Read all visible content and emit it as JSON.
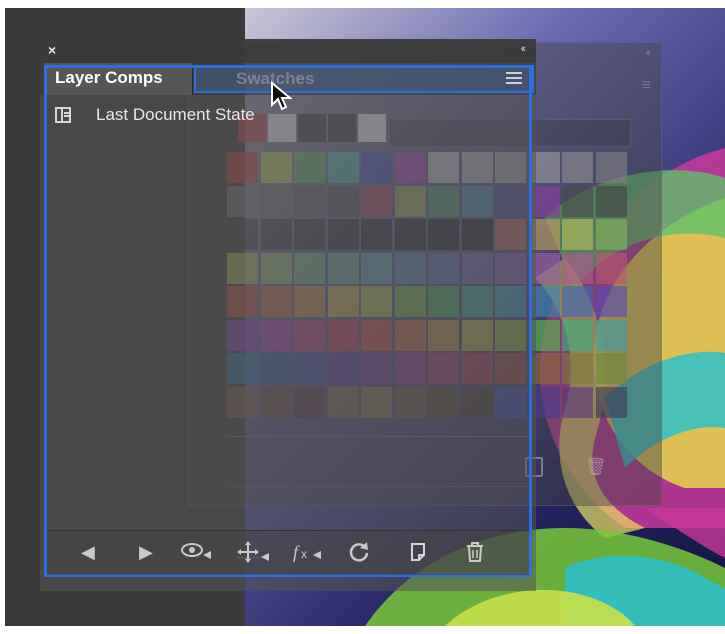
{
  "panel": {
    "close_glyph": "×",
    "collapse_glyph": "‹‹",
    "tabs": [
      {
        "label": "Layer Comps",
        "active": true
      },
      {
        "label": "Swatches",
        "active": false,
        "dragging": true
      }
    ],
    "menu_icon": "hamburger-menu-icon",
    "comps": [
      {
        "label": "Last Document State",
        "icon": "layer-comp-icon"
      }
    ],
    "toolbar": [
      {
        "name": "previous-comp-button",
        "icon": "triangle-left-icon",
        "glyph": "◀"
      },
      {
        "name": "next-comp-button",
        "icon": "triangle-right-icon",
        "glyph": "▶"
      },
      {
        "name": "visibility-button",
        "icon": "eye-icon",
        "glyph": "👁"
      },
      {
        "name": "position-button",
        "icon": "move-arrows-icon",
        "glyph": "✥"
      },
      {
        "name": "style-button",
        "icon": "fx-icon",
        "glyph": "fx"
      },
      {
        "name": "update-button",
        "icon": "refresh-icon",
        "glyph": "↻"
      },
      {
        "name": "new-comp-button",
        "icon": "new-page-icon",
        "glyph": ""
      },
      {
        "name": "delete-button",
        "icon": "trash-icon",
        "glyph": "🗑"
      }
    ]
  },
  "ghost_panel": {
    "close_glyph": "×",
    "collapse_glyph": "‹‹",
    "menu_glyph": "≡",
    "trash_glyph": "🗑"
  },
  "swatches": {
    "recent": [
      "#b13f47",
      "#e0e0e0",
      "#3a3a3a",
      "#3a3a3a",
      "#e8e8e8"
    ],
    "grid": [
      [
        "#c23b3b",
        "#b8c84a",
        "#5fb05f",
        "#49b3a8",
        "#3d4fb8",
        "#b03fb8",
        "#c6c6c6",
        "#b6b6b6",
        "#a9a9a9",
        "#9a9a9a",
        "#8d8d8d",
        "#808080"
      ],
      [
        "#767676",
        "#6a6a6a",
        "#5e5e5e",
        "#525252",
        "#b0465a",
        "#9fb04a",
        "#4e9a6b",
        "#4a8fb2",
        "#474c9a",
        "#8c3c9f",
        "#4b4b4b",
        "#444444"
      ],
      [
        "#3e3e3e",
        "#373737",
        "#323232",
        "#2c2c2c",
        "#262626",
        "#222222",
        "#1f1f1f",
        "#1b1b1b",
        "#c46b5a",
        "#c4a05a",
        "#b8c05a",
        "#7fb85a"
      ],
      [
        "#a8b85f",
        "#8fb86a",
        "#77b07a",
        "#6aa890",
        "#5fa0a8",
        "#5a88b0",
        "#6078b0",
        "#7068b0",
        "#8a62b0",
        "#a05ea8",
        "#b05a90",
        "#b85a70"
      ],
      [
        "#c24a3a",
        "#c86a3a",
        "#c88a3a",
        "#c8aa3a",
        "#a8c03a",
        "#78b83a",
        "#4ab05a",
        "#3ab08a",
        "#3aa8b0",
        "#3a88b8",
        "#3a68b8",
        "#5a4ab8"
      ],
      [
        "#8a3ab8",
        "#b03aa8",
        "#c03a78",
        "#c83a50",
        "#d04a3a",
        "#d06a3a",
        "#c8903a",
        "#b8b03a",
        "#90b83a",
        "#5ab84a",
        "#3ab07a",
        "#3aa0a8"
      ],
      [
        "#2e6ea0",
        "#2e5a98",
        "#3a4a98",
        "#5a3a98",
        "#7a3a98",
        "#963a90",
        "#a83a70",
        "#b03a50",
        "#a04a3a",
        "#906a3a",
        "#807a3a",
        "#6a8a3a"
      ],
      [
        "#7a5a4a",
        "#6a4a3a",
        "#5a3a3a",
        "#7a6a4a",
        "#8a7a4a",
        "#6a5a3a",
        "#5a4a2a",
        "#4a3a2a",
        "#3a4ab0",
        "#4a3a8a",
        "#5a3a7a",
        "#3a3a5a"
      ]
    ]
  },
  "cursor_icon": "arrow-cursor-icon"
}
